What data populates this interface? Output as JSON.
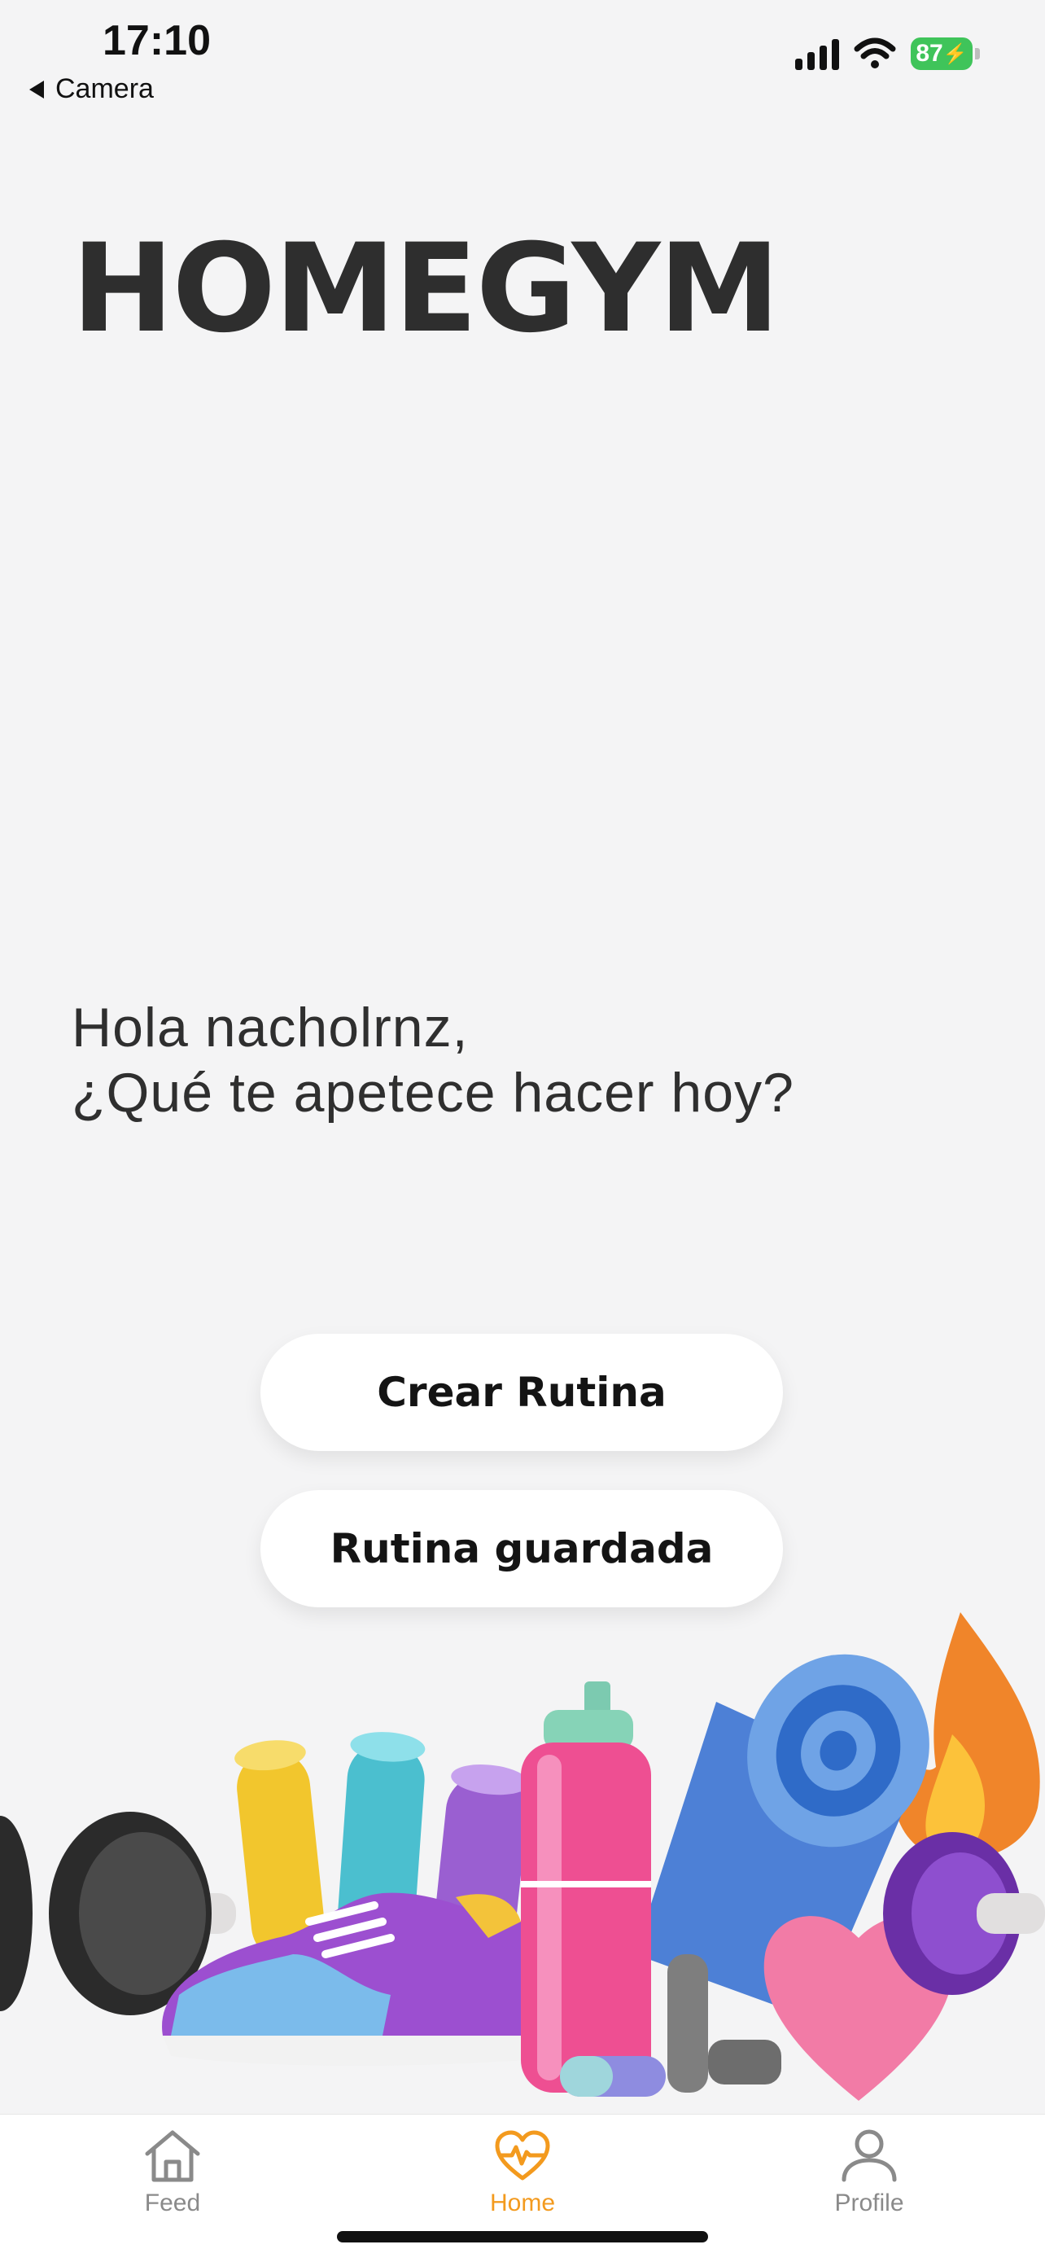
{
  "status_bar": {
    "time": "17:10",
    "back_label": "Camera",
    "battery": "87"
  },
  "app": {
    "title": "HOMEGYM"
  },
  "greeting": {
    "line1": "Hola nacholrnz,",
    "line2": "¿Qué te apetece hacer hoy?"
  },
  "actions": {
    "create_label": "Crear Rutina",
    "saved_label": "Rutina guardada"
  },
  "tabbar": {
    "items": [
      {
        "label": "Feed",
        "icon": "house-icon",
        "active": false
      },
      {
        "label": "Home",
        "icon": "heart-pulse-icon",
        "active": true
      },
      {
        "label": "Profile",
        "icon": "person-icon",
        "active": false
      }
    ],
    "active_color": "#f39a1e",
    "inactive_color": "#8a8a8a"
  },
  "colors": {
    "background": "#f4f4f5",
    "battery": "#3fc45a"
  }
}
